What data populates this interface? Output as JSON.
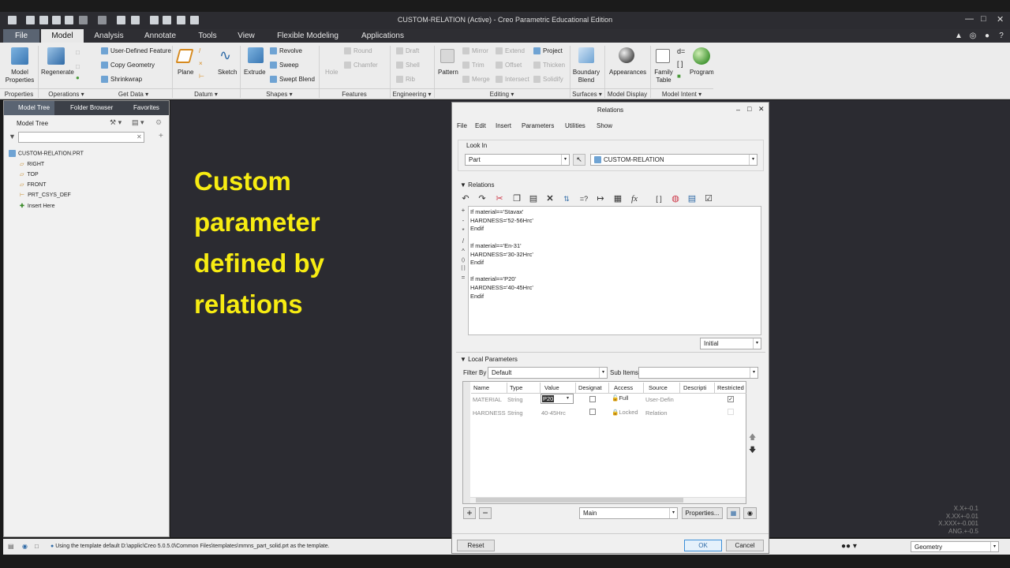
{
  "window": {
    "title": "CUSTOM-RELATION (Active) - Creo Parametric Educational Edition"
  },
  "tabs": [
    "File",
    "Model",
    "Analysis",
    "Annotate",
    "Tools",
    "View",
    "Flexible Modeling",
    "Applications"
  ],
  "ribbon": {
    "model_properties": "Model\nProperties",
    "regenerate": "Regenerate",
    "user_defined_feature": "User-Defined Feature",
    "copy_geometry": "Copy Geometry",
    "shrinkwrap": "Shrinkwrap",
    "plane": "Plane",
    "sketch": "Sketch",
    "extrude": "Extrude",
    "revolve": "Revolve",
    "sweep": "Sweep",
    "swept_blend": "Swept Blend",
    "hole": "Hole",
    "round": "Round",
    "chamfer": "Chamfer",
    "draft": "Draft",
    "shell": "Shell",
    "rib": "Rib",
    "pattern": "Pattern",
    "mirror": "Mirror",
    "trim": "Trim",
    "merge": "Merge",
    "extend": "Extend",
    "offset": "Offset",
    "intersect": "Intersect",
    "project": "Project",
    "thicken": "Thicken",
    "solidify": "Solidify",
    "boundary_blend": "Boundary\nBlend",
    "appearances": "Appearances",
    "family_table": "Family\nTable",
    "program": "Program",
    "groups": [
      "Properties",
      "Operations",
      "Get Data",
      "Datum",
      "Shapes",
      "Features",
      "Engineering",
      "Editing",
      "Surfaces",
      "Model Display",
      "Model Intent"
    ]
  },
  "left_panel": {
    "tabs": [
      "Model Tree",
      "Folder Browser",
      "Favorites"
    ],
    "header": "Model Tree",
    "tree": [
      "CUSTOM-RELATION.PRT",
      "RIGHT",
      "TOP",
      "FRONT",
      "PRT_CSYS_DEF",
      "Insert Here"
    ]
  },
  "overlay_text": [
    "Custom",
    "parameter",
    "defined by",
    "relations"
  ],
  "dialog": {
    "title": "Relations",
    "menu": [
      "File",
      "Edit",
      "Insert",
      "Parameters",
      "Utilities",
      "Show"
    ],
    "look_in_label": "Look In",
    "look_in_type": "Part",
    "look_in_name": "CUSTOM-RELATION",
    "relations_label": "Relations",
    "side_symbols": [
      "+",
      "-",
      "*",
      "/",
      "^",
      "()",
      "[ ]",
      "="
    ],
    "code": [
      "If material=='Stavax'",
      "HARDNESS='52-56Hrc'",
      "Endif",
      "",
      "If material=='En-31'",
      "HARDNESS='30-32Hrc'",
      "Endif",
      "",
      "If material=='P20'",
      "HARDNESS='40-45Hrc'",
      "Endif"
    ],
    "initial": "Initial",
    "local_params_label": "Local Parameters",
    "filter_by_label": "Filter By",
    "filter_by_value": "Default",
    "sub_items_label": "Sub Items",
    "columns": [
      "Name",
      "Type",
      "Value",
      "Designat",
      "Access",
      "Source",
      "Descripti",
      "Restricted"
    ],
    "rows": [
      {
        "name": "MATERIAL",
        "type": "String",
        "value": "P20",
        "access": "Full",
        "source": "User-Defin"
      },
      {
        "name": "HARDNESS",
        "type": "String",
        "value": "40-45Hrc",
        "access": "Locked",
        "source": "Relation"
      }
    ],
    "main_select": "Main",
    "properties_btn": "Properties...",
    "reset_btn": "Reset",
    "ok_btn": "OK",
    "cancel_btn": "Cancel"
  },
  "status": {
    "message": "Using the template default D:\\applic\\Creo 5.0.5.0\\Common Files\\templates\\mmns_part_solid.prt as the template.",
    "filter": "Geometry"
  },
  "tolerances": [
    "X.X+-0.1",
    "X.XX+-0.01",
    "X.XXX+-0.001",
    "ANG.+-0.5"
  ]
}
